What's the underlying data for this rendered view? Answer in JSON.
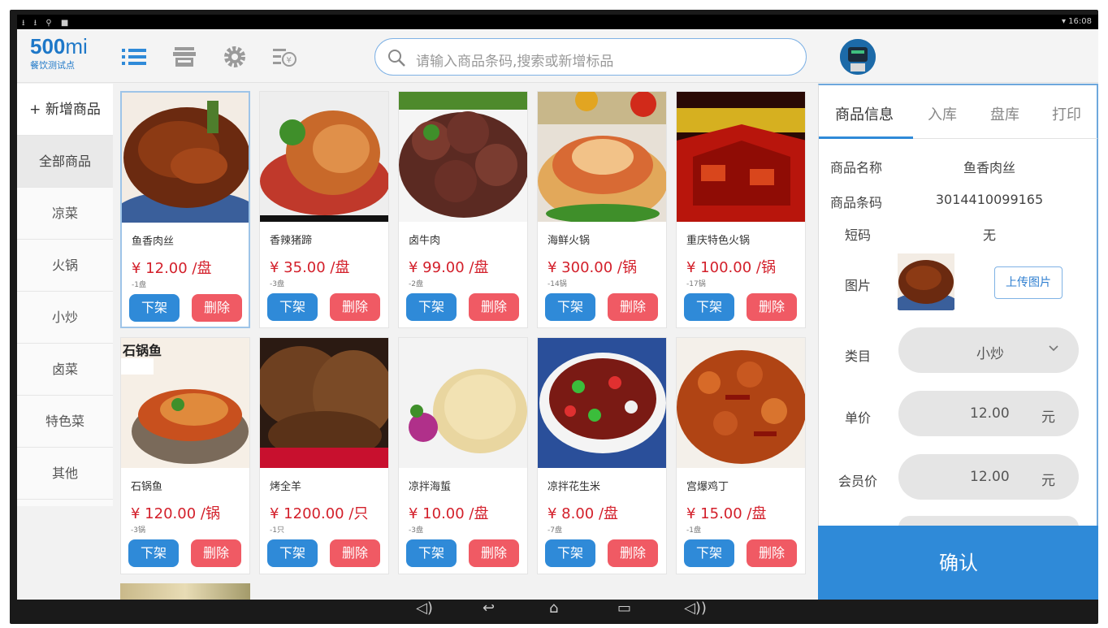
{
  "status_bar": {
    "left_icons": "⭳ ⭳ ⚲ ■",
    "time": "16:08"
  },
  "logo": {
    "brand_number": "500",
    "brand_suffix": "mi",
    "subtitle": "餐饮测试点"
  },
  "search": {
    "placeholder": "请输入商品条码,搜索或新增标品"
  },
  "toolbar_icons": [
    "list-icon",
    "store-icon",
    "settings-icon",
    "cash-register-icon"
  ],
  "sidebar": {
    "add_label": "+ 新增商品",
    "items": [
      "全部商品",
      "凉菜",
      "火锅",
      "小炒",
      "卤菜",
      "特色菜",
      "其他"
    ],
    "active_index": 0
  },
  "products": [
    {
      "name": "鱼香肉丝",
      "price": "¥ 12.00 /盘",
      "stock": "-1盘",
      "off_label": "下架",
      "delete_label": "删除"
    },
    {
      "name": "香辣猪蹄",
      "price": "¥ 35.00 /盘",
      "stock": "-3盘",
      "off_label": "下架",
      "delete_label": "删除"
    },
    {
      "name": "卤牛肉",
      "price": "¥ 99.00 /盘",
      "stock": "-2盘",
      "off_label": "下架",
      "delete_label": "删除"
    },
    {
      "name": "海鲜火锅",
      "price": "¥ 300.00 /锅",
      "stock": "-14锅",
      "off_label": "下架",
      "delete_label": "删除"
    },
    {
      "name": "重庆特色火锅",
      "price": "¥ 100.00 /锅",
      "stock": "-17锅",
      "off_label": "下架",
      "delete_label": "删除"
    },
    {
      "name": "石锅鱼",
      "price": "¥ 120.00 /锅",
      "stock": "-3锅",
      "off_label": "下架",
      "delete_label": "删除"
    },
    {
      "name": "烤全羊",
      "price": "¥ 1200.00 /只",
      "stock": "-1只",
      "off_label": "下架",
      "delete_label": "删除"
    },
    {
      "name": "凉拌海蜇",
      "price": "¥ 10.00 /盘",
      "stock": "-3盘",
      "off_label": "下架",
      "delete_label": "删除"
    },
    {
      "name": "凉拌花生米",
      "price": "¥ 8.00 /盘",
      "stock": "-7盘",
      "off_label": "下架",
      "delete_label": "删除"
    },
    {
      "name": "宫爆鸡丁",
      "price": "¥ 15.00 /盘",
      "stock": "-1盘",
      "off_label": "下架",
      "delete_label": "删除"
    }
  ],
  "stamp_text": "石锅鱼",
  "detail": {
    "tabs": [
      "商品信息",
      "入库",
      "盘库",
      "打印"
    ],
    "active_tab": 0,
    "fields": {
      "name_label": "商品名称",
      "name_value": "鱼香肉丝",
      "barcode_label": "商品条码",
      "barcode_value": "3014410099165",
      "shortcode_label": "短码",
      "shortcode_value": "无",
      "image_label": "图片",
      "upload_label": "上传图片",
      "category_label": "类目",
      "category_value": "小炒",
      "price_label": "单价",
      "price_value": "12.00",
      "price_unit": "元",
      "member_label": "会员价",
      "member_value": "12.00",
      "member_unit": "元"
    },
    "confirm_label": "确认"
  },
  "nav_bar": [
    "volume-down-icon",
    "back-icon",
    "home-icon",
    "recents-icon",
    "volume-up-icon"
  ]
}
